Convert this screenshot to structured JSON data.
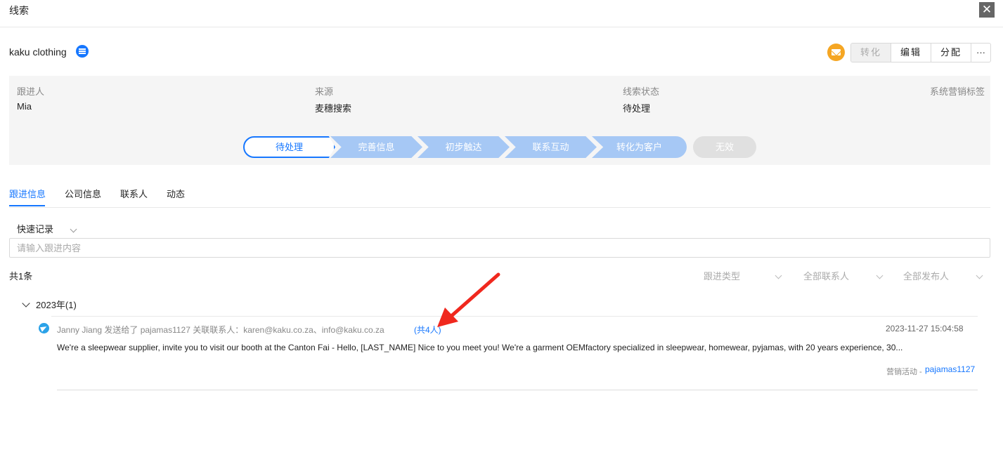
{
  "window": {
    "title": "线索",
    "close_label": "✕"
  },
  "lead": {
    "name": "kaku clothing"
  },
  "actions": {
    "convert": "转化",
    "edit": "编辑",
    "assign": "分配",
    "more": "···"
  },
  "info": {
    "owner_label": "跟进人",
    "owner_value": "Mia",
    "source_label": "来源",
    "source_value": "麦穗搜索",
    "status_label": "线索状态",
    "status_value": "待处理",
    "tags_label": "系统营销标签"
  },
  "stages": [
    "待处理",
    "完善信息",
    "初步触达",
    "联系互动",
    "转化为客户"
  ],
  "stage_invalid": "无效",
  "tabs": [
    "跟进信息",
    "公司信息",
    "联系人",
    "动态"
  ],
  "quick_record": {
    "label": "快速记录",
    "placeholder": "请输入跟进内容"
  },
  "list": {
    "total": "共1条",
    "filters": [
      "跟进类型",
      "全部联系人",
      "全部发布人"
    ],
    "year_group": "2023年(1)",
    "record": {
      "header": "Janny Jiang 发送给了 pajamas1127  关联联系人：karen@kaku.co.za、info@kaku.co.za",
      "count": "(共4人)",
      "time": "2023-11-27 15:04:58",
      "body": "We're a sleepwear supplier, invite you to visit our booth at the Canton Fai - Hello, [LAST_NAME] Nice to you meet you! We're a garment OEMfactory specialized in sleepwear, homewear, pyjamas, with 20 years experience, 30...",
      "foot_label": "营销活动 -",
      "foot_link": "pajamas1127"
    }
  },
  "colors": {
    "accent": "#1677ff",
    "stage_fill": "#a6c8f5",
    "annotation_arrow": "#f0281e",
    "mail": "#f5a623"
  }
}
